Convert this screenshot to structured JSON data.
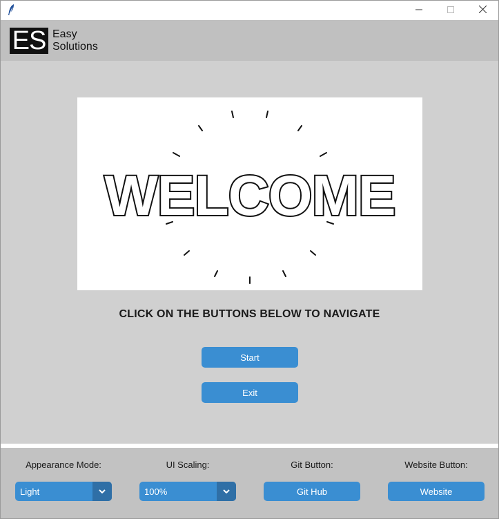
{
  "header": {
    "logo_mark": "ES",
    "logo_line1": "Easy",
    "logo_line2": "Solutions"
  },
  "hero": {
    "image_text": "WELCOME"
  },
  "main": {
    "caption": "CLICK ON THE BUTTONS BELOW TO NAVIGATE",
    "start_label": "Start",
    "exit_label": "Exit"
  },
  "footer": {
    "appearance_label": "Appearance Mode:",
    "appearance_value": "Light",
    "scaling_label": "UI Scaling:",
    "scaling_value": "100%",
    "git_label": "Git Button:",
    "git_button": "Git Hub",
    "website_label": "Website Button:",
    "website_button": "Website"
  },
  "colors": {
    "accent": "#3a8ed2",
    "accent_dark": "#2f6fa6",
    "background": "#d0d0d0",
    "header_bg": "#c0c0c0"
  },
  "icons": {
    "app": "feather-icon",
    "minimize": "minimize-icon",
    "maximize": "maximize-icon",
    "close": "close-icon",
    "dropdown": "chevron-down-icon"
  }
}
